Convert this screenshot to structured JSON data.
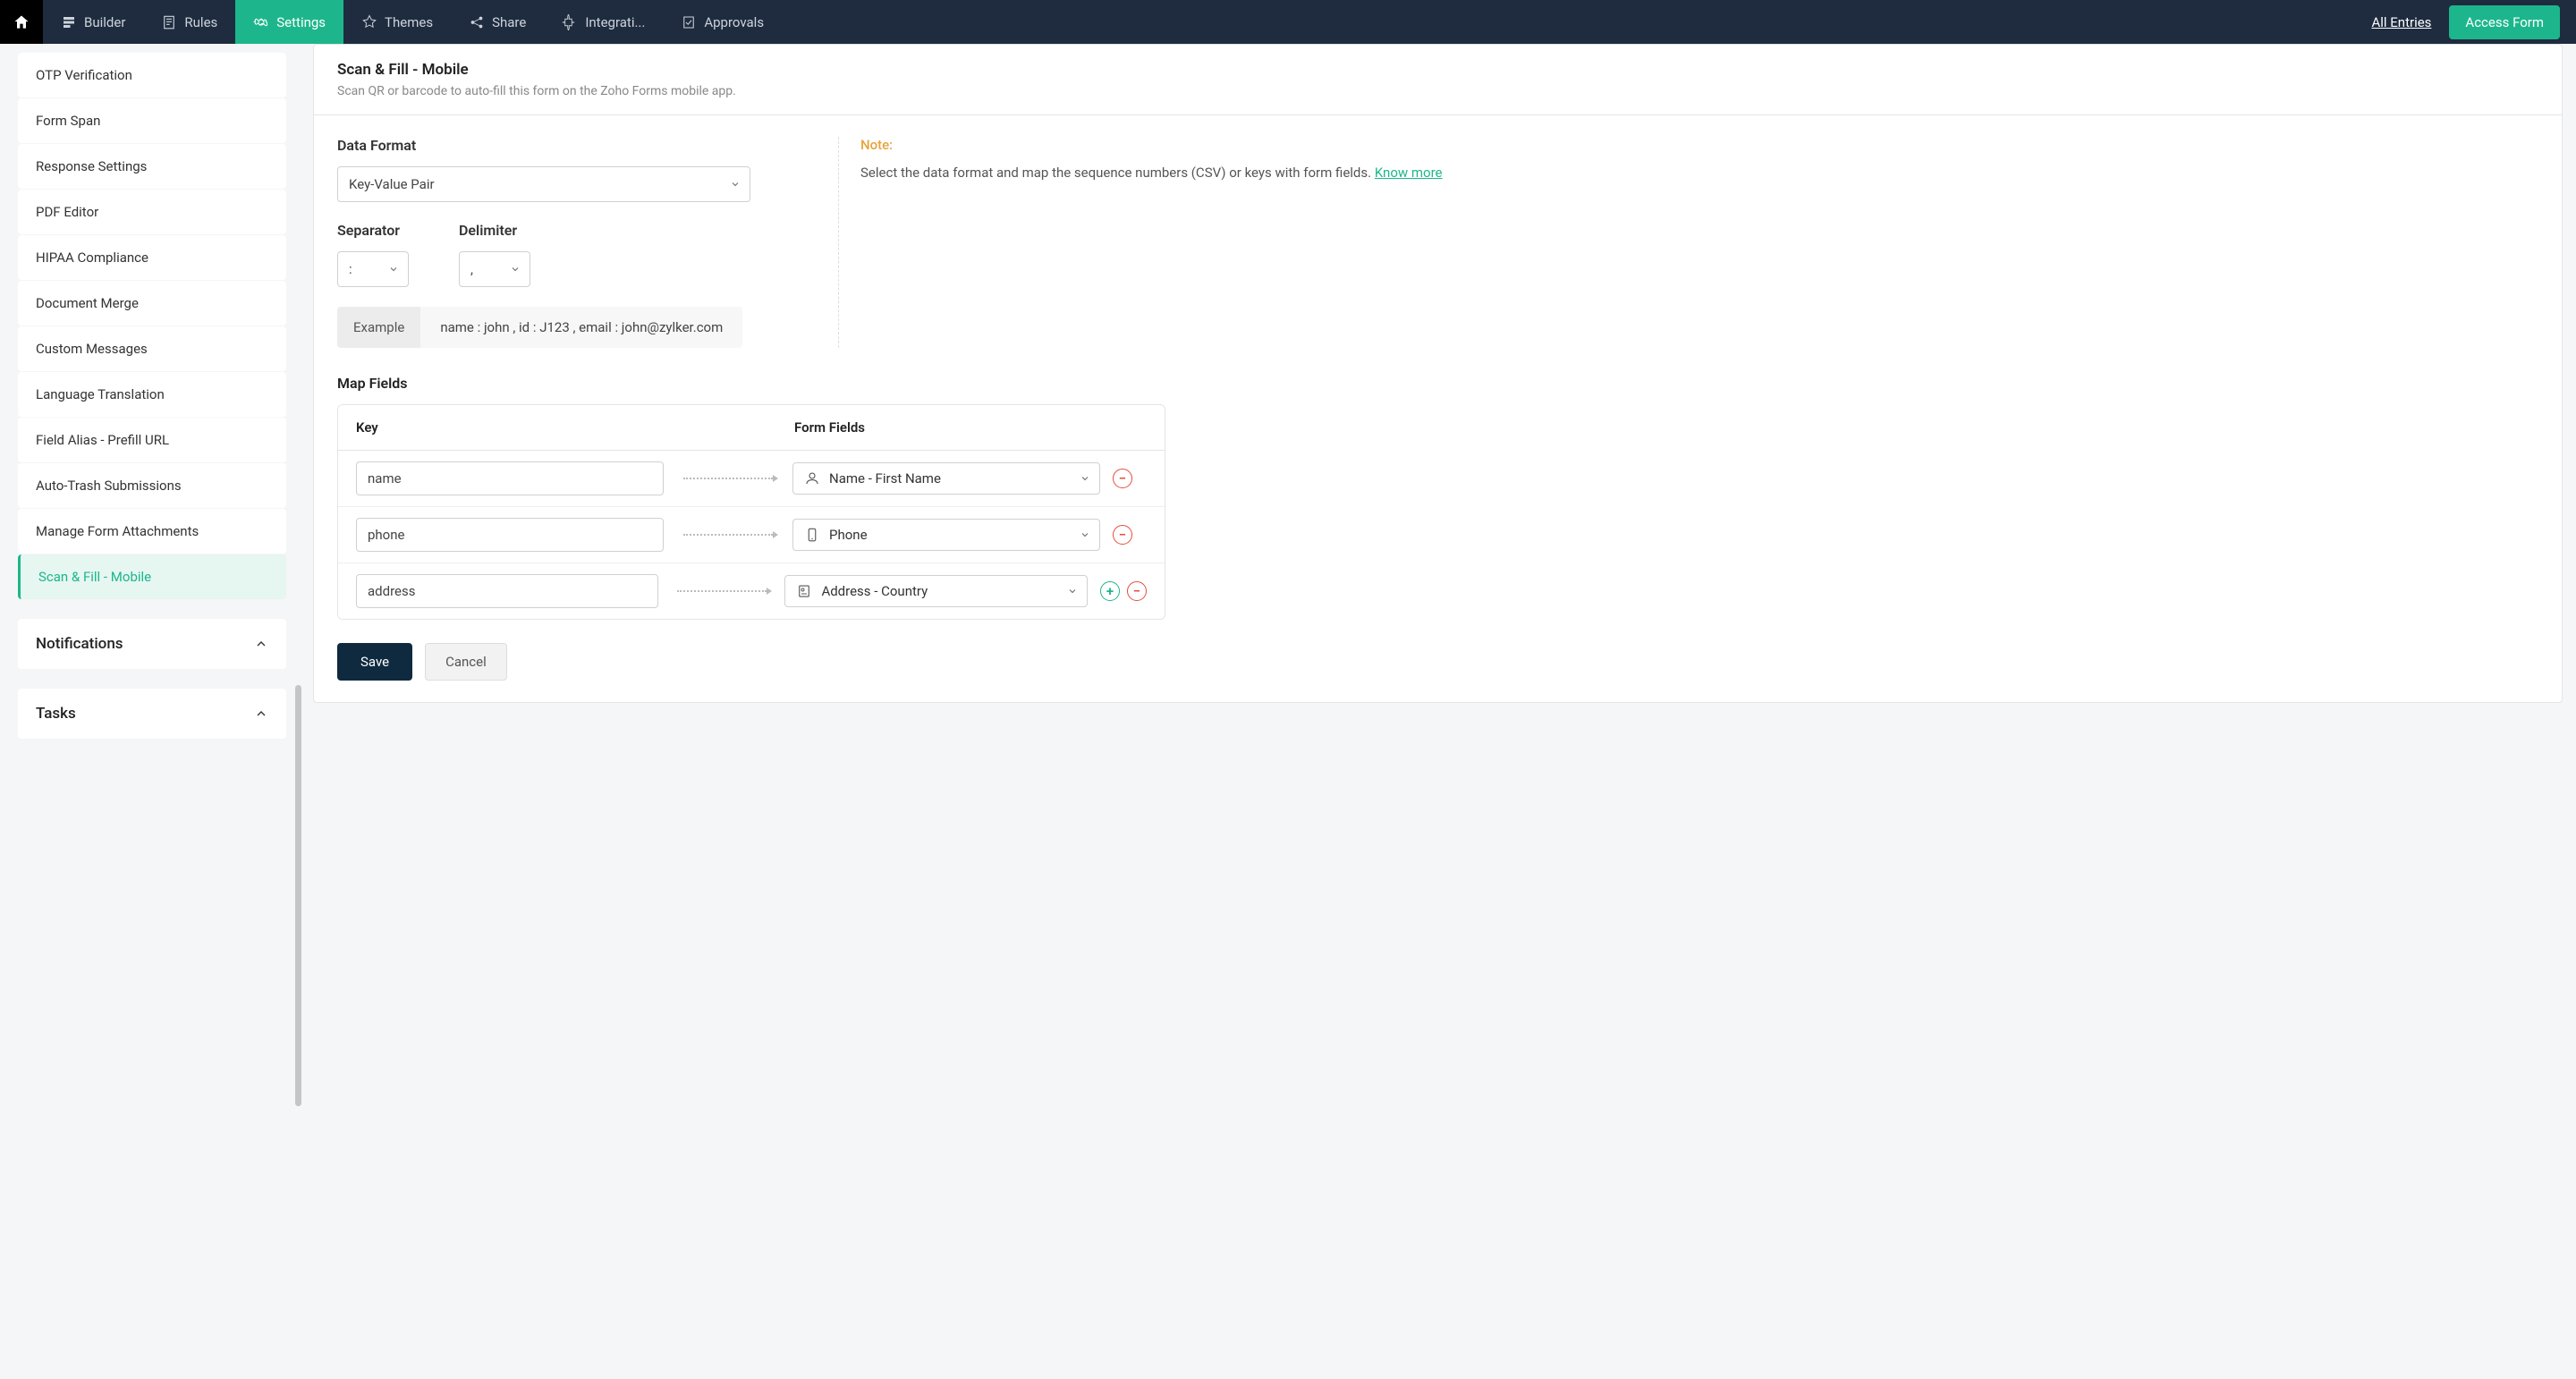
{
  "nav": {
    "tabs": [
      {
        "label": "Builder"
      },
      {
        "label": "Rules"
      },
      {
        "label": "Settings"
      },
      {
        "label": "Themes"
      },
      {
        "label": "Share"
      },
      {
        "label": "Integrati..."
      },
      {
        "label": "Approvals"
      }
    ],
    "all_entries": "All Entries",
    "access_form": "Access Form"
  },
  "sidebar": {
    "items": [
      "OTP Verification",
      "Form Span",
      "Response Settings",
      "PDF Editor",
      "HIPAA Compliance",
      "Document Merge",
      "Custom Messages",
      "Language Translation",
      "Field Alias - Prefill URL",
      "Auto-Trash Submissions",
      "Manage Form Attachments",
      "Scan & Fill - Mobile"
    ],
    "groups": [
      "Notifications",
      "Tasks"
    ]
  },
  "page": {
    "title": "Scan & Fill - Mobile",
    "subtitle": "Scan QR or barcode to auto-fill this form on the Zoho Forms mobile app.",
    "data_format_label": "Data Format",
    "data_format_value": "Key-Value Pair",
    "separator_label": "Separator",
    "separator_value": ":",
    "delimiter_label": "Delimiter",
    "delimiter_value": ",",
    "example_label": "Example",
    "example_text": "name : john , id : J123 , email : john@zylker.com",
    "note_title": "Note:",
    "note_text": "Select the data format and map the sequence numbers (CSV) or keys with form fields. ",
    "note_link": "Know more",
    "map_fields_label": "Map Fields",
    "col_key": "Key",
    "col_field": "Form Fields",
    "rows": [
      {
        "key": "name",
        "field": "Name - First Name"
      },
      {
        "key": "phone",
        "field": "Phone"
      },
      {
        "key": "address",
        "field": "Address - Country"
      }
    ],
    "save": "Save",
    "cancel": "Cancel"
  }
}
